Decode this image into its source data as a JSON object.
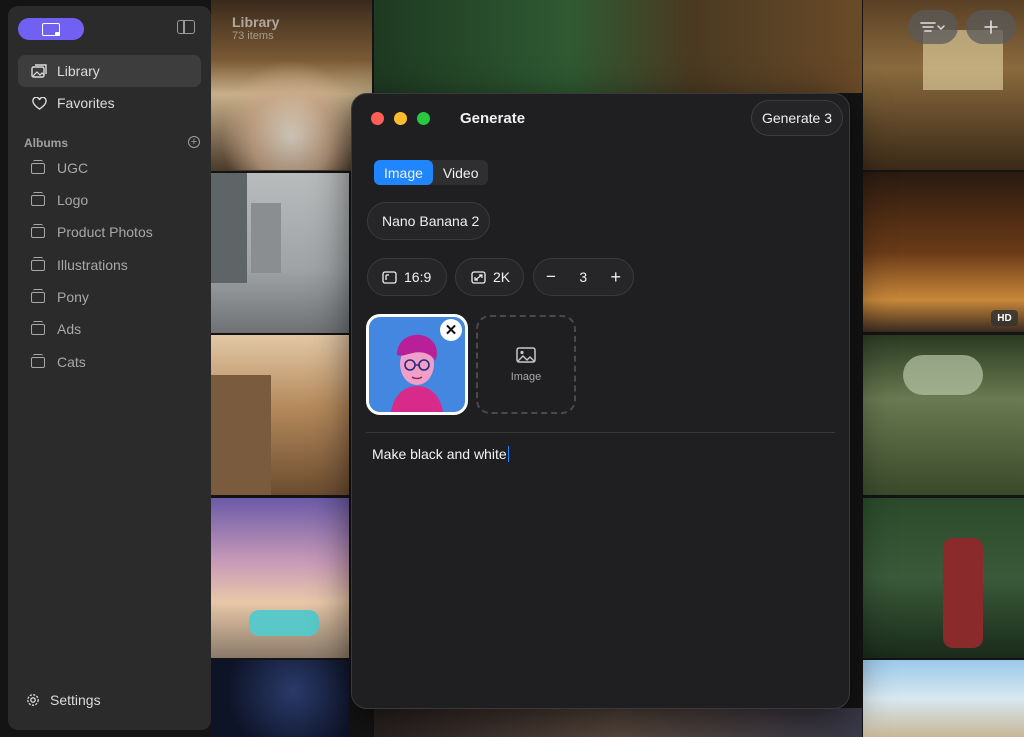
{
  "sidebar": {
    "nav": [
      {
        "label": "Library",
        "icon": "photo-library-icon",
        "active": true
      },
      {
        "label": "Favorites",
        "icon": "heart-icon",
        "active": false
      }
    ],
    "albums_label": "Albums",
    "albums": [
      "UGC",
      "Logo",
      "Product Photos",
      "Illustrations",
      "Pony",
      "Ads",
      "Cats"
    ],
    "settings_label": "Settings"
  },
  "library": {
    "title": "Library",
    "count": "73 items",
    "badge": "HD"
  },
  "generate_panel": {
    "title": "Generate",
    "generate_button": "Generate 3",
    "tabs": [
      {
        "label": "Image",
        "selected": true
      },
      {
        "label": "Video",
        "selected": false
      }
    ],
    "model": "Nano Banana 2",
    "aspect_ratio": "16:9",
    "resolution": "2K",
    "count": "3",
    "add_image_label": "Image",
    "prompt": "Make black and white"
  },
  "colors": {
    "accent": "#1f86ff",
    "sidebar_toggle": "#7061f2",
    "close": "#ff5f57",
    "minimize": "#febc2e",
    "zoom": "#28c840"
  }
}
